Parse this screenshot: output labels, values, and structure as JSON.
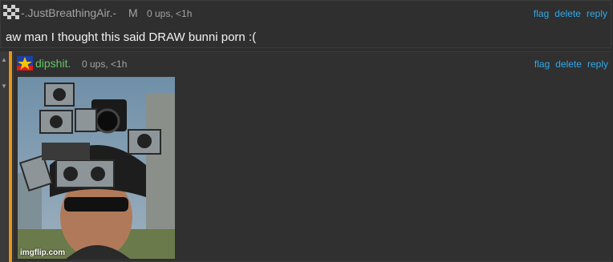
{
  "comment1": {
    "username": "-.JustBreathingAir.-",
    "badge": "M",
    "ups": "0 ups, <1h",
    "actions": {
      "flag": "flag",
      "delete": "delete",
      "reply": "reply"
    },
    "text": "aw man I thought this said DRAW bunni porn :("
  },
  "comment2": {
    "username": "dipshit.",
    "ups": "0 ups, <1h",
    "actions": {
      "flag": "flag",
      "delete": "delete",
      "reply": "reply"
    },
    "image_watermark": "imgflip.com"
  },
  "colors": {
    "link": "#31a9ea",
    "username_green": "#65c466",
    "accent_bar": "#e6951e",
    "background": "#2e2e2e"
  },
  "icons": {
    "collapse_up": "triangle-up",
    "collapse_down": "triangle-down"
  }
}
